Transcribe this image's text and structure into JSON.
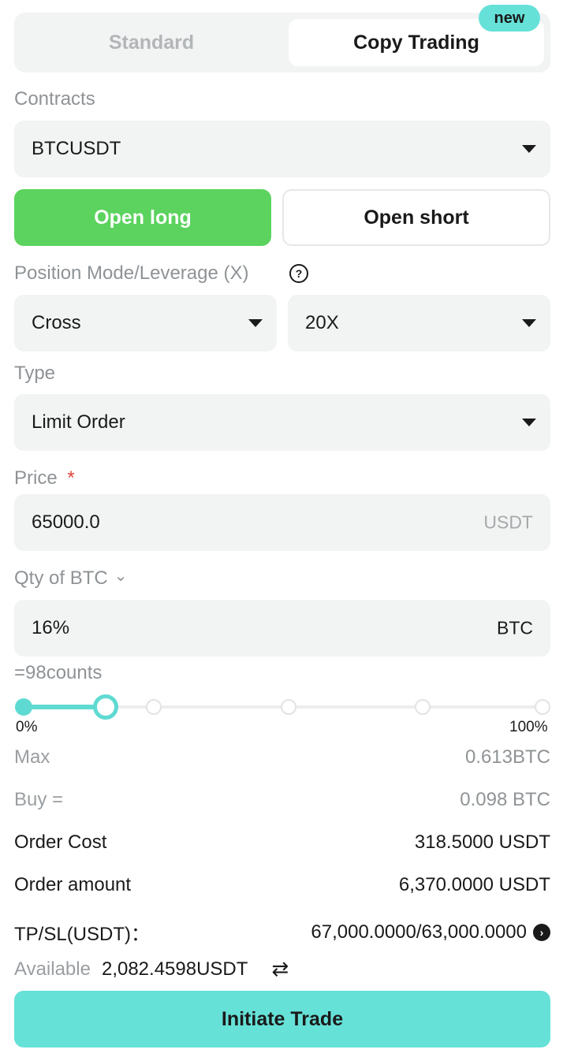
{
  "tabs": {
    "standard": "Standard",
    "copy_trading": "Copy Trading",
    "badge": "new"
  },
  "contracts": {
    "label": "Contracts",
    "value": "BTCUSDT"
  },
  "side": {
    "open_long": "Open long",
    "open_short": "Open short"
  },
  "position": {
    "label": "Position Mode/Leverage (X)",
    "help_glyph": "?",
    "mode": "Cross",
    "leverage": "20X"
  },
  "type": {
    "label": "Type",
    "value": "Limit Order"
  },
  "price": {
    "label": "Price",
    "required_mark": "*",
    "value": "65000.0",
    "unit": "USDT"
  },
  "qty": {
    "label": "Qty of BTC",
    "chevron": "⌄",
    "value": "16%",
    "unit": "BTC",
    "counts": "=98counts"
  },
  "slider": {
    "level_percent": 16,
    "min_label": "0%",
    "max_label": "100%"
  },
  "summary": {
    "max_label": "Max",
    "max_value": "0.613BTC",
    "buy_label": "Buy =",
    "buy_value": "0.098 BTC",
    "cost_label": "Order Cost",
    "cost_value": "318.5000 USDT",
    "amount_label": "Order amount",
    "amount_value": "6,370.0000 USDT",
    "tpsl_label": "TP/SL(USDT)：",
    "tpsl_value": "67,000.0000/63,000.0000",
    "available_label": "Available",
    "available_value": "2,082.4598USDT",
    "transfer_glyph": "⇄"
  },
  "action": {
    "initiate": "Initiate Trade"
  },
  "colors": {
    "accent": "#66e1d8",
    "long_green": "#5bd35e",
    "required_red": "#e0443a"
  },
  "icons": [
    "help-icon",
    "caret-down-icon",
    "chevron-down-icon",
    "arrow-right-circle-icon",
    "transfer-icon"
  ]
}
